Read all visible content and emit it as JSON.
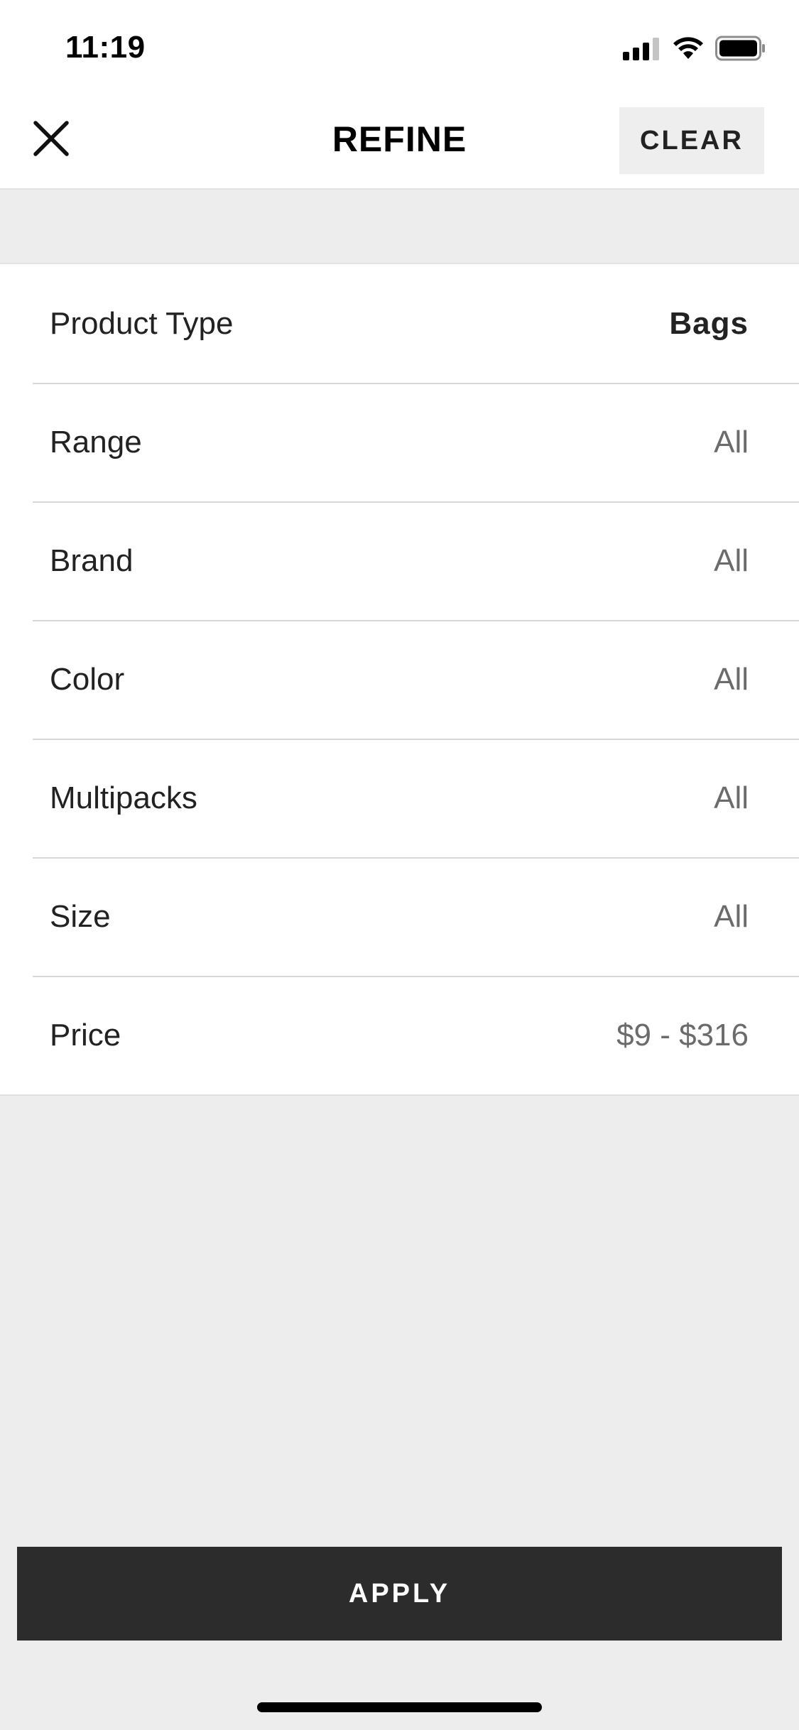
{
  "status_bar": {
    "time": "11:19"
  },
  "header": {
    "title": "REFINE",
    "clear_label": "CLEAR"
  },
  "filters": [
    {
      "label": "Product Type",
      "value": "Bags",
      "selected": true
    },
    {
      "label": "Range",
      "value": "All",
      "selected": false
    },
    {
      "label": "Brand",
      "value": "All",
      "selected": false
    },
    {
      "label": "Color",
      "value": "All",
      "selected": false
    },
    {
      "label": "Multipacks",
      "value": "All",
      "selected": false
    },
    {
      "label": "Size",
      "value": "All",
      "selected": false
    },
    {
      "label": "Price",
      "value": "$9 - $316",
      "selected": false
    }
  ],
  "footer": {
    "apply_label": "APPLY"
  },
  "icons": {
    "close": "close-icon",
    "signal": "signal-icon",
    "wifi": "wifi-icon",
    "battery": "battery-icon"
  },
  "colors": {
    "background": "#ededed",
    "surface": "#ffffff",
    "apply_button": "#2c2c2c",
    "clear_button": "#eeeeee",
    "value_text": "#6b6b6b"
  }
}
